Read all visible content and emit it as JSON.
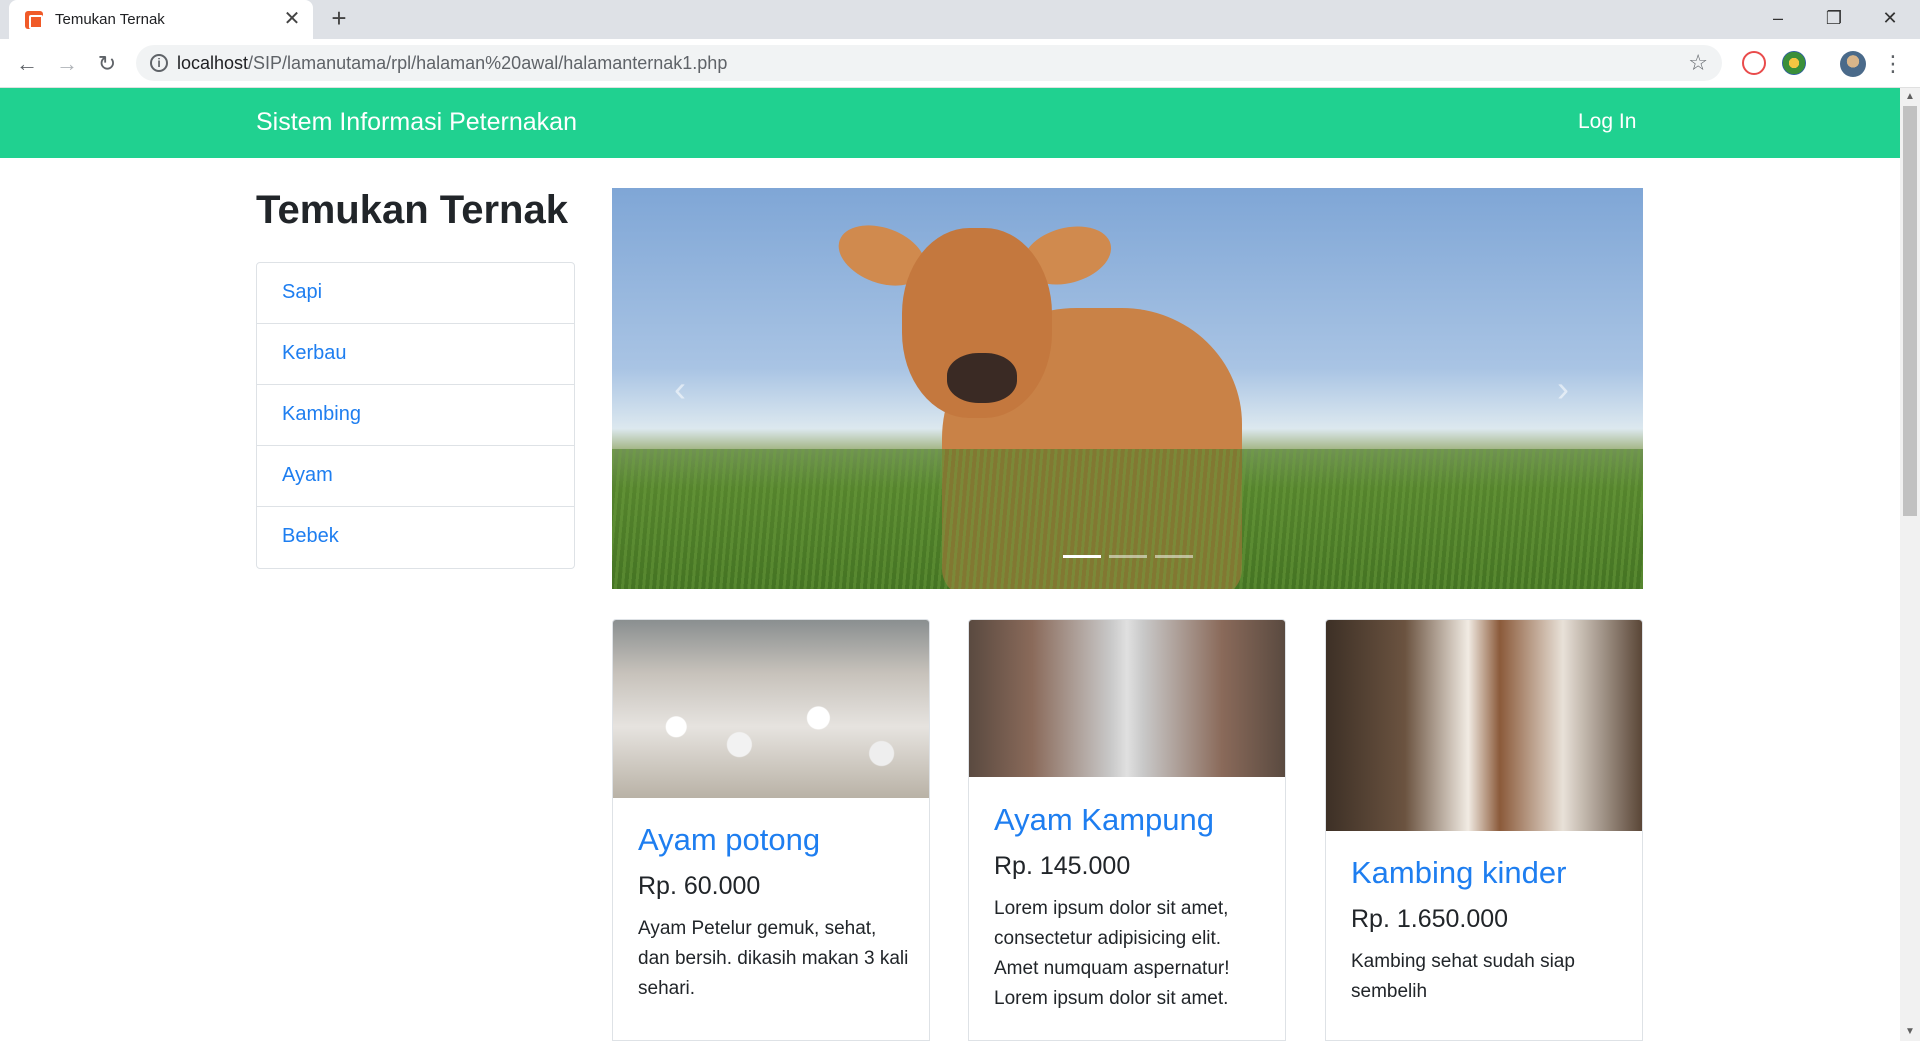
{
  "browser": {
    "tab_title": "Temukan Ternak",
    "tab_close": "✕",
    "new_tab": "+",
    "url_host": "localhost",
    "url_path": "/SIP/lamanutama/rpl/halaman%20awal/halamanternak1.php",
    "window_controls": [
      "–",
      "❐",
      "✕"
    ]
  },
  "navbar": {
    "brand": "Sistem Informasi Peternakan",
    "login": "Log In"
  },
  "page": {
    "heading": "Temukan Ternak",
    "categories": [
      "Sapi",
      "Kerbau",
      "Kambing",
      "Ayam",
      "Bebek"
    ],
    "carousel": {
      "prev": "‹",
      "next": "›",
      "indicator_count": 3,
      "active_indicator": 0
    },
    "products": [
      {
        "title": "Ayam potong",
        "price": "Rp. 60.000",
        "description": "Ayam Petelur gemuk, sehat, dan bersih. dikasih makan 3 kali sehari."
      },
      {
        "title": "Ayam Kampung",
        "price": "Rp. 145.000",
        "description": "Lorem ipsum dolor sit amet, consectetur adipisicing elit. Amet numquam aspernatur! Lorem ipsum dolor sit amet."
      },
      {
        "title": "Kambing kinder",
        "price": "Rp. 1.650.000",
        "description": "Kambing sehat sudah siap sembelih"
      }
    ]
  },
  "colors": {
    "navbar_bg": "#20d190",
    "link": "#1e7ef0",
    "text": "#212529"
  }
}
